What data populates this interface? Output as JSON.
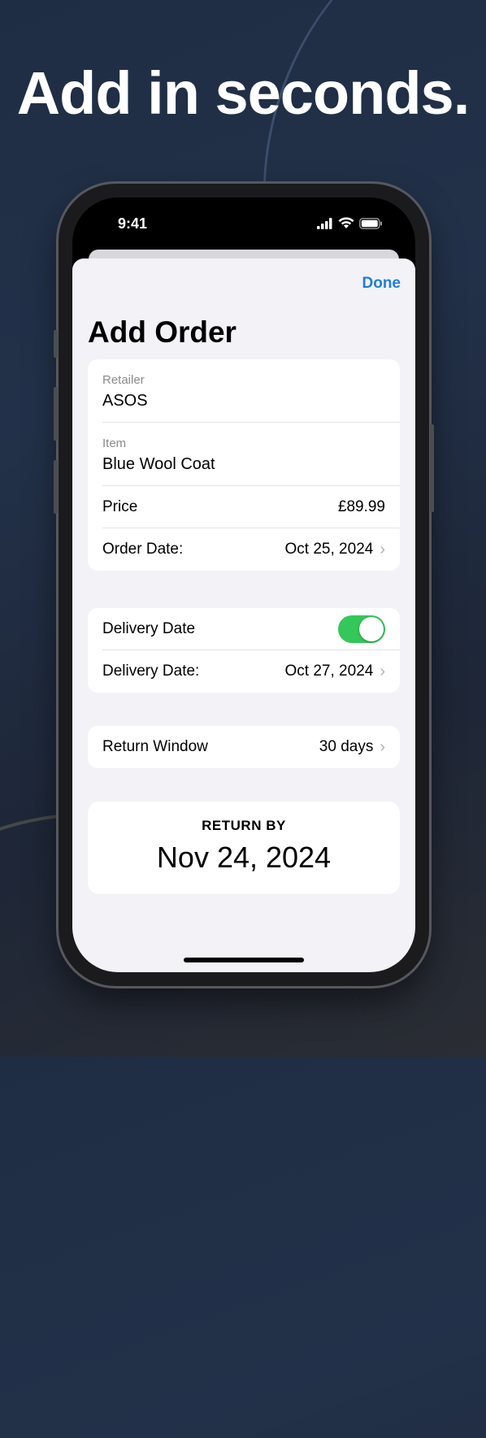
{
  "headline": "Add in seconds.",
  "status_bar": {
    "time": "9:41",
    "icons": [
      "signal-icon",
      "wifi-icon",
      "battery-icon"
    ]
  },
  "nav": {
    "done_label": "Done"
  },
  "title": "Add Order",
  "order": {
    "retailer_label": "Retailer",
    "retailer_value": "ASOS",
    "item_label": "Item",
    "item_value": "Blue Wool Coat",
    "price_label": "Price",
    "price_value": "£89.99",
    "order_date_label": "Order Date:",
    "order_date_value": "Oct 25, 2024"
  },
  "delivery": {
    "toggle_label": "Delivery Date",
    "toggle_on": true,
    "date_label": "Delivery Date:",
    "date_value": "Oct 27, 2024"
  },
  "return_window": {
    "label": "Return Window",
    "value": "30 days"
  },
  "return_by": {
    "label": "RETURN BY",
    "date": "Nov 24, 2024"
  },
  "colors": {
    "accent": "#1f7fd0",
    "toggle_on": "#34c759",
    "sheet_bg": "#f2f2f7"
  }
}
